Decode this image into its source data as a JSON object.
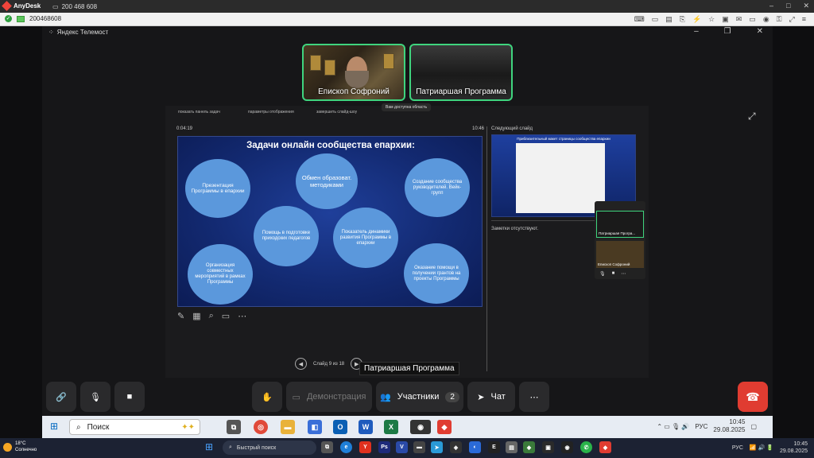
{
  "anydesk": {
    "brand": "AnyDesk",
    "tab_id": "200 468 608",
    "address_id": "200468608"
  },
  "telemost": {
    "window_title": "Яндекс Телемост",
    "participants": [
      {
        "name": "Епископ Софроний"
      },
      {
        "name": "Патриаршая Программа"
      }
    ],
    "share_toolbar": {
      "item1": "показать панель задач",
      "item2": "параметры отображения",
      "item3": "завершить слайд-шоу",
      "badge": "Вам доступна область"
    },
    "slide_timer": "0:04:19",
    "slide_clock": "10:46",
    "slide": {
      "title": "Задачи онлайн сообщества епархии:",
      "bubbles": [
        "Презентация Программы в епархии",
        "Обмен образоват. методиками",
        "Создание сообщества руководителей. Вейк-групп",
        "Помощь в подготовке приходских педагогов",
        "Показатель динамики развития Программы в епархии",
        "Организация совместных мероприятий в рамках Программы",
        "Оказание помощи в получении грантов на проекты Программы"
      ]
    },
    "next_slide_label": "Следующий слайд",
    "next_slide_title": "Приблизительный макет страницы сообщества епархии",
    "notes_text": "Заметки отсутствуют.",
    "slide_counter": "Слайд 9 из 18",
    "tooltip": "Патриаршая Программа",
    "mini_captions": [
      "Патриаршая Програ...",
      "Епископ Софроний"
    ],
    "bottom": {
      "demo_label": "Демонстрация",
      "participants_label": "Участники",
      "participants_count": "2",
      "chat_label": "Чат"
    }
  },
  "taskbar_remote": {
    "search_placeholder": "Поиск",
    "lang": "РУС",
    "time": "10:45",
    "date": "29.08.2025"
  },
  "taskbar_local": {
    "weather_temp": "18°C",
    "weather_text": "Солнечно",
    "search_placeholder": "Быстрый поиск",
    "lang": "РУС",
    "time": "10:45",
    "date": "29.08.2025"
  }
}
